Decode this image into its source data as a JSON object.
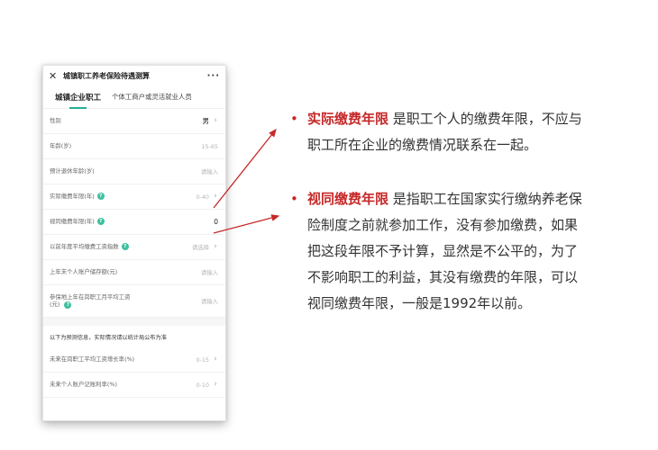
{
  "app": {
    "title": "城镇职工养老保险待遇测算",
    "close_glyph": "✕",
    "more_glyph": "···"
  },
  "tabs": [
    {
      "label": "城镇企业职工",
      "active": true
    },
    {
      "label": "个体工商户或灵活就业人员",
      "active": false
    }
  ],
  "form": {
    "gender": {
      "label": "性别",
      "value": "男"
    },
    "age": {
      "label": "年龄(岁)",
      "placeholder": "15-65"
    },
    "retire_age": {
      "label": "预计退休年龄(岁)",
      "placeholder": "请输入"
    },
    "actual_years": {
      "label": "实际缴费年限(年)",
      "placeholder": "0-40"
    },
    "deemed_years": {
      "label": "视同缴费年限(年)",
      "value": "0"
    },
    "wage_index": {
      "label": "以前年度平均缴费工资指数",
      "placeholder": "请选择"
    },
    "account_balance": {
      "label": "上年末个人账户储存额(元)",
      "placeholder": "请输入"
    },
    "avg_wage": {
      "label_line1": "参保地上年在岗职工月平均工资",
      "label_line2": "(元)",
      "placeholder": "请输入"
    },
    "forecast_note": "以下为预测信息，实际情况请以统计局公布为准",
    "wage_growth": {
      "label": "未来在岗职工平均工资增长率(%)",
      "placeholder": "0-15"
    },
    "account_interest": {
      "label": "未来个人账户记账利率(%)",
      "placeholder": "0-10"
    }
  },
  "bullets": [
    {
      "term": "实际缴费年限",
      "line1_rest": " 是职工个人的缴费年限，不应与",
      "lines": [
        "职工所在企业的缴费情况联系在一起。"
      ]
    },
    {
      "term": "视同缴费年限",
      "line1_rest": " 是指职工在国家实行缴纳养老保",
      "lines": [
        "险制度之前就参加工作，没有参加缴费，如果",
        "把这段年限不予计算，显然是不公平的，为了",
        "不影响职工的利益，其没有缴费的年限，可以",
        "视同缴费年限，一般是1992年以前。"
      ]
    }
  ],
  "colors": {
    "accent_red": "#c62828",
    "tab_underline": "#26b08f",
    "help_icon": "#3fc0a0"
  },
  "icons": {
    "help": "?",
    "chevron": "›",
    "bullet": "•"
  }
}
